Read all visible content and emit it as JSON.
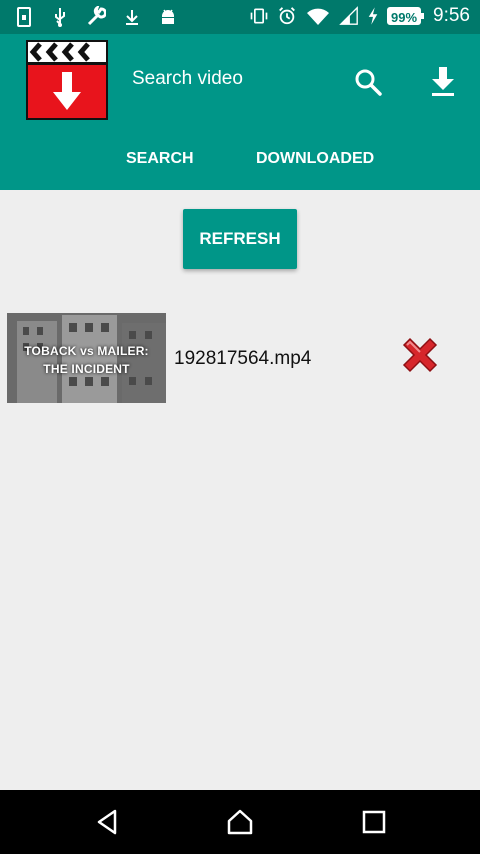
{
  "status_bar": {
    "battery": "99%",
    "time": "9:56",
    "icons_left": [
      "sim-icon",
      "usb-icon",
      "wrench-icon",
      "download-arrow-icon",
      "android-icon"
    ],
    "icons_right": [
      "vibrate-icon",
      "alarm-icon",
      "wifi-icon",
      "signal-icon",
      "charging-icon"
    ]
  },
  "app_bar": {
    "search_placeholder": "Search video",
    "colors": {
      "primary": "#009688",
      "primary_dark": "#00796b",
      "logo_red": "#e8141c"
    }
  },
  "tabs": [
    {
      "label": "SEARCH"
    },
    {
      "label": "DOWNLOADED"
    }
  ],
  "refresh_label": "REFRESH",
  "videos": [
    {
      "file_name": "192817564.mp4",
      "thumbnail_line1": "TOBACK vs MAILER:",
      "thumbnail_line2": "THE INCIDENT"
    }
  ],
  "nav": [
    "back-icon",
    "home-icon",
    "recents-icon"
  ]
}
